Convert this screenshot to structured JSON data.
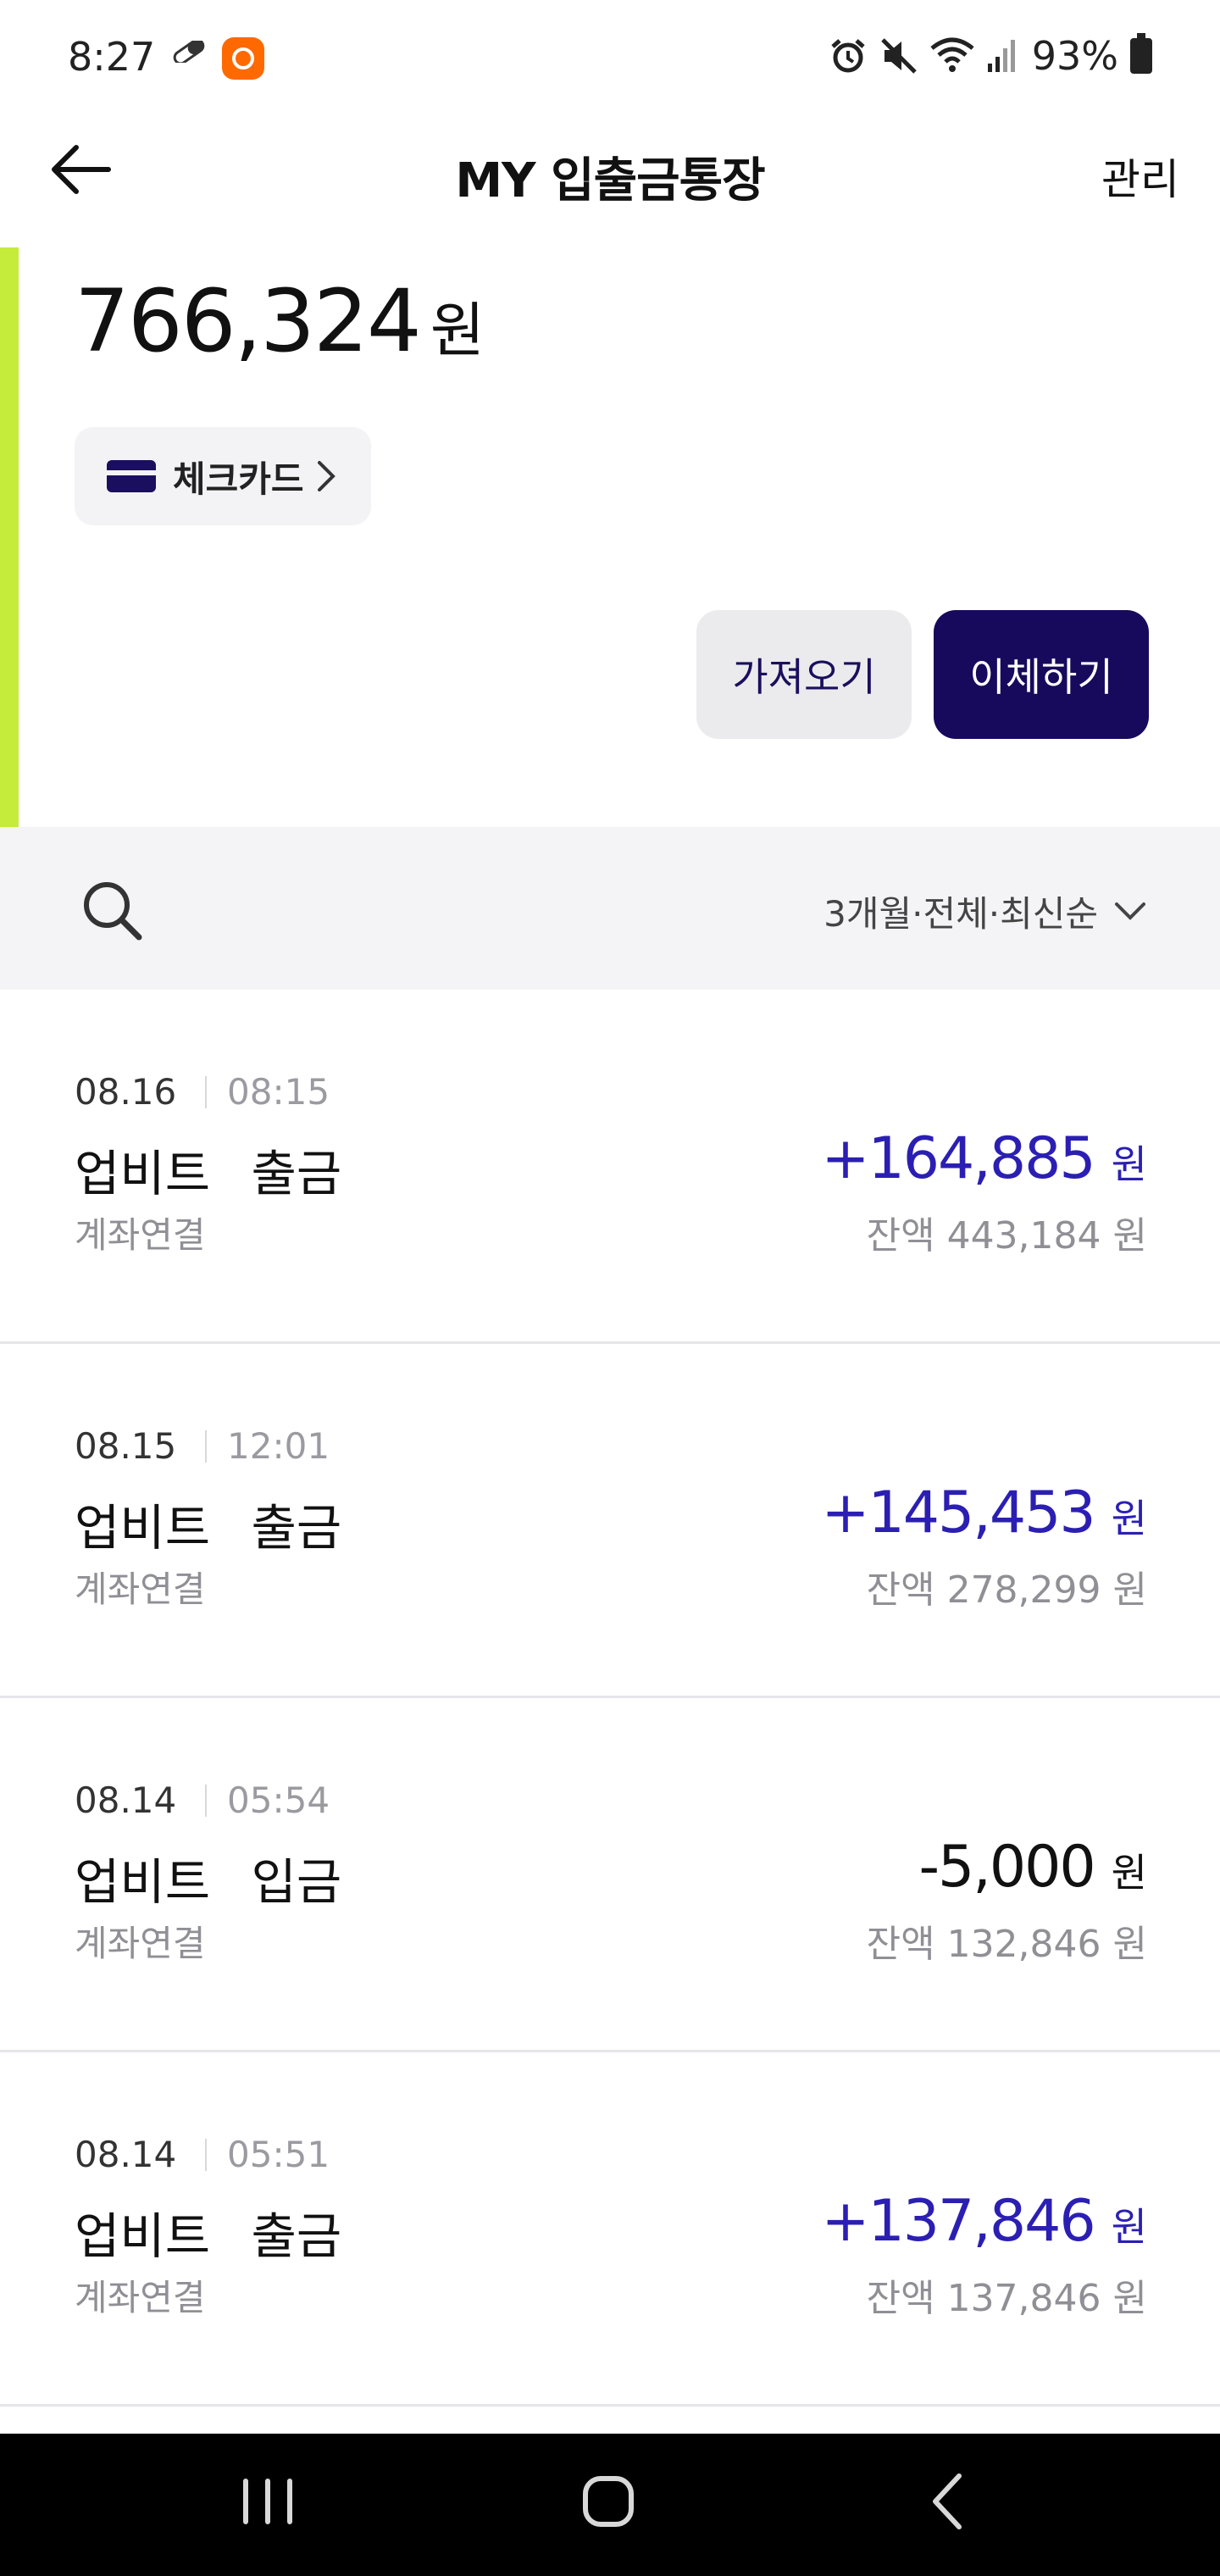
{
  "status_bar": {
    "time": "8:27",
    "battery": "93%"
  },
  "header": {
    "title": "MY 입출금통장",
    "manage_label": "관리"
  },
  "account": {
    "balance": "766,324",
    "currency": "원",
    "card_label": "체크카드"
  },
  "actions": {
    "fetch_label": "가져오기",
    "transfer_label": "이체하기"
  },
  "filter": {
    "label": "3개월·전체·최신순"
  },
  "transactions": [
    {
      "date": "08.16",
      "time": "08:15",
      "name": "업비트 출금",
      "sub": "계좌연결",
      "amount": "+164,885",
      "unit": "원",
      "balance": "잔액 443,184 원"
    },
    {
      "date": "08.15",
      "time": "12:01",
      "name": "업비트 출금",
      "sub": "계좌연결",
      "amount": "+145,453",
      "unit": "원",
      "balance": "잔액 278,299 원"
    },
    {
      "date": "08.14",
      "time": "05:54",
      "name": "업비트 입금",
      "sub": "계좌연결",
      "amount": "-5,000",
      "unit": "원",
      "balance": "잔액 132,846 원"
    },
    {
      "date": "08.14",
      "time": "05:51",
      "name": "업비트 출금",
      "sub": "계좌연결",
      "amount": "+137,846",
      "unit": "원",
      "balance": "잔액 137,846 원"
    }
  ],
  "colors": {
    "accent": "#c5ec3a",
    "primary": "#170a5c",
    "positive": "#2b1fb3"
  }
}
